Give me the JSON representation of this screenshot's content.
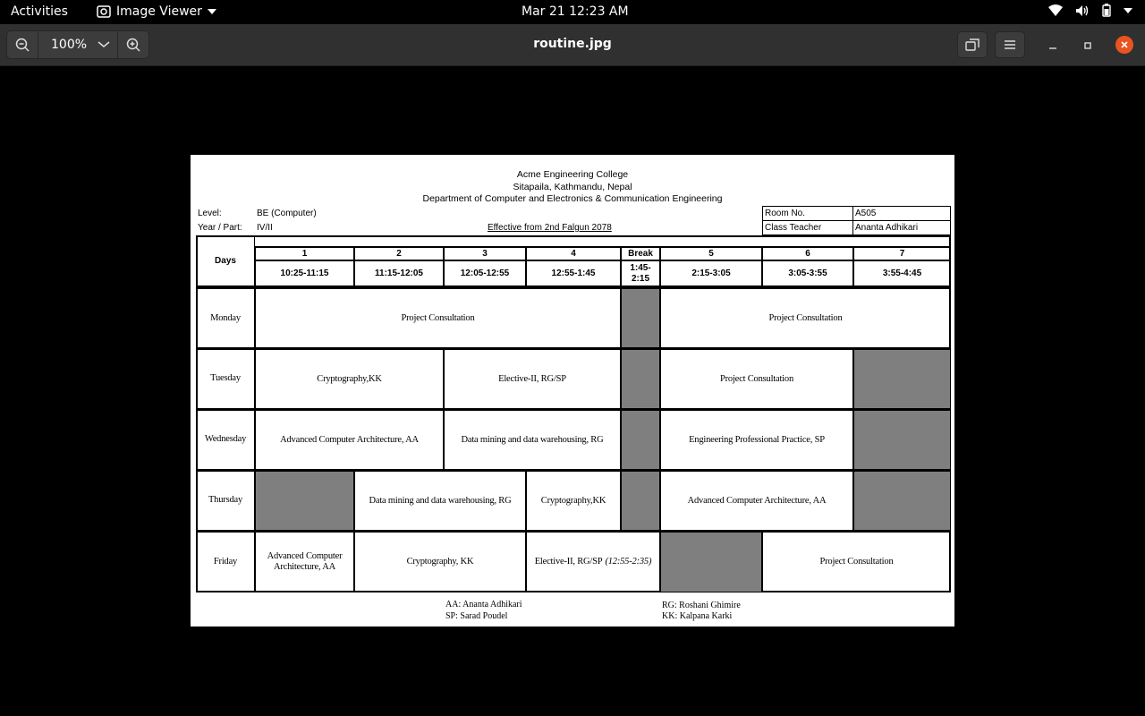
{
  "topbar": {
    "activities": "Activities",
    "app_name": "Image Viewer",
    "clock": "Mar 21  12:23 AM"
  },
  "headerbar": {
    "zoom_level": "100%",
    "title": "routine.jpg"
  },
  "document": {
    "college": "Acme Engineering College",
    "address": "Sitapaila, Kathmandu, Nepal",
    "department": "Department of Computer and Electronics & Communication Engineering",
    "level_label": "Level:",
    "level_value": "BE (Computer)",
    "yearpart_label": "Year / Part:",
    "yearpart_value": "IV/II",
    "effective": "Effective from 2nd Falgun 2078",
    "room_label": "Room No.",
    "room_value": "A505",
    "teacher_label": "Class Teacher",
    "teacher_value": "Ananta Adhikari",
    "days_header": "Days",
    "periods": [
      {
        "num": "1",
        "time": "10:25-11:15"
      },
      {
        "num": "2",
        "time": "11:15-12:05"
      },
      {
        "num": "3",
        "time": "12:05-12:55"
      },
      {
        "num": "4",
        "time": "12:55-1:45"
      },
      {
        "num": "Break",
        "time": "1:45-\n2:15"
      },
      {
        "num": "5",
        "time": "2:15-3:05"
      },
      {
        "num": "6",
        "time": "3:05-3:55"
      },
      {
        "num": "7",
        "time": "3:55-4:45"
      }
    ],
    "days": [
      "Monday",
      "Tuesday",
      "Wednesday",
      "Thursday",
      "Friday"
    ],
    "sessions": {
      "mon_a": "Project Consultation",
      "mon_b": "Project Consultation",
      "tue_a": "Cryptography,KK",
      "tue_b": "Elective-II, RG/SP",
      "tue_c": "Project Consultation",
      "wed_a": "Advanced Computer Architecture, AA",
      "wed_b": "Data mining and data warehousing, RG",
      "wed_c": "Engineering Professional Practice, SP",
      "thu_a": "Data mining and data warehousing, RG",
      "thu_b": "Cryptography,KK",
      "thu_c": "Advanced Computer Architecture, AA",
      "fri_a": "Advanced Computer Architecture, AA",
      "fri_b": "Cryptography, KK",
      "fri_c": "Elective-II, RG/SP",
      "fri_c_time": "(12:55-2:35)",
      "fri_d": "Project Consultation"
    },
    "legend": {
      "aa": "AA: Ananta Adhikari",
      "sp": "SP: Sarad Poudel",
      "rg": "RG: Roshani Ghimire",
      "kk": "KK: Kalpana Karki"
    }
  },
  "colors": {
    "close_button": "#e95420",
    "blocked_cell": "#7f7f7f"
  }
}
